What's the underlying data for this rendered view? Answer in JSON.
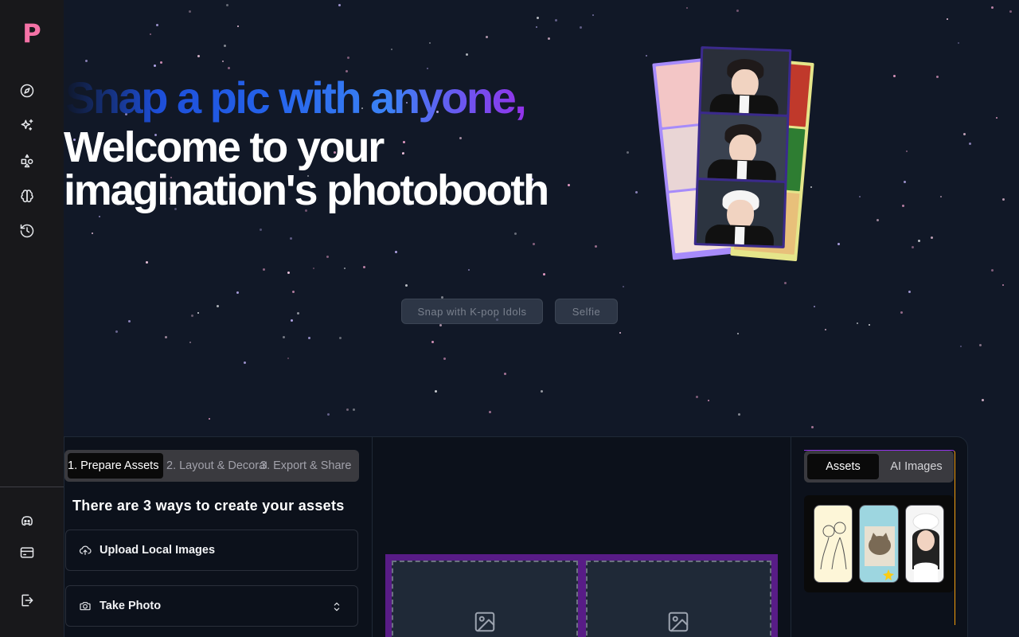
{
  "sidebar": {
    "logo": "P",
    "nav": [
      {
        "name": "compass-icon"
      },
      {
        "name": "sparkles-icon"
      },
      {
        "name": "shapes-icon"
      },
      {
        "name": "brain-icon"
      },
      {
        "name": "history-icon"
      }
    ],
    "bottom": [
      {
        "name": "discord-icon"
      },
      {
        "name": "billing-icon"
      },
      {
        "name": "logout-icon"
      }
    ]
  },
  "hero": {
    "subtitle": "Snap a pic with anyone,",
    "title_line1": "Welcome to your",
    "title_line2": "imagination's photobooth"
  },
  "modes": [
    {
      "label": "Snap with K-pop Idols"
    },
    {
      "label": "Selfie"
    }
  ],
  "steps": {
    "tabs": [
      {
        "label": "1. Prepare Assets"
      },
      {
        "label": "2. Layout & Decorate"
      },
      {
        "label": "3. Export & Share"
      }
    ],
    "active": 0,
    "ways_title": "There are 3 ways to create your assets",
    "options": [
      {
        "label": "Upload Local Images",
        "icon": "upload-cloud-icon"
      },
      {
        "label": "Take Photo",
        "icon": "camera-icon"
      }
    ]
  },
  "canvas": {
    "slots": [
      {
        "icon": "image-icon"
      },
      {
        "icon": "image-icon"
      }
    ]
  },
  "assets": {
    "tabs": [
      {
        "label": "Assets"
      },
      {
        "label": "AI Images"
      }
    ],
    "active": 0,
    "thumbnails": [
      {
        "name": "sketch-couple-thumbnail"
      },
      {
        "name": "cat-sticker-thumbnail"
      },
      {
        "name": "chef-girl-thumbnail"
      }
    ]
  },
  "colors": {
    "background": "#111827",
    "sidebar": "#18181b",
    "logo": "#f472a6",
    "canvas_frame": "#581c87"
  }
}
